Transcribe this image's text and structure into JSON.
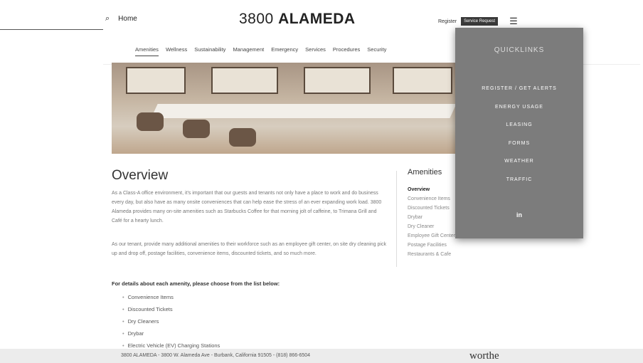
{
  "header": {
    "search_label": "Home",
    "logo_light": "3800 ",
    "logo_bold": "ALAMEDA",
    "register": "Register",
    "service_request": "Service Request"
  },
  "nav": {
    "tabs": [
      {
        "label": "Amenities"
      },
      {
        "label": "Wellness"
      },
      {
        "label": "Sustainability"
      },
      {
        "label": "Management"
      },
      {
        "label": "Emergency"
      },
      {
        "label": "Services"
      },
      {
        "label": "Procedures"
      },
      {
        "label": "Security"
      }
    ]
  },
  "main": {
    "title": "Overview",
    "para1": "As a Class-A office environment, it's important that our guests and tenants not only have a place to work and do business every day, but also have as many onsite conveniences that can help ease the stress of an ever expanding work load. 3800 Alameda provides many on-site amenities such as Starbucks Coffee for that morning jolt of caffeine, to Trimana Grill and Café for a hearty lunch.",
    "para2": "As our tenant, provide many additional amenities to their workforce such as an employee gift center, on site dry cleaning pick up and drop off, postage facilities, convenience items, discounted tickets, and so much more.",
    "details_heading": "For details about each amenity, please choose from the list below:",
    "list": [
      "Convenience Items",
      "Discounted Tickets",
      "Dry Cleaners",
      "Drybar",
      "Electric Vehicle (EV) Charging Stations"
    ]
  },
  "sidebar": {
    "title": "Amenities",
    "items": [
      "Overview",
      "Convenience Items",
      "Discounted Tickets",
      "Drybar",
      "Dry Cleaner",
      "Employee Gift Center",
      "Postage Facilities",
      "Restaurants & Cafe"
    ]
  },
  "quicklinks": {
    "title": "QUICKLINKS",
    "items": [
      "REGISTER / GET ALERTS",
      "ENERGY USAGE",
      "LEASING",
      "FORMS",
      "WEATHER",
      "TRAFFIC"
    ],
    "linkedin": "in"
  },
  "footer": {
    "address": "3800 ALAMEDA - 3800 W. Alameda Ave - Burbank, California 91505 - (818) 866-6504",
    "brand": "worthe"
  },
  "icons": {
    "search": "search-icon",
    "menu": "hamburger-menu-icon"
  }
}
